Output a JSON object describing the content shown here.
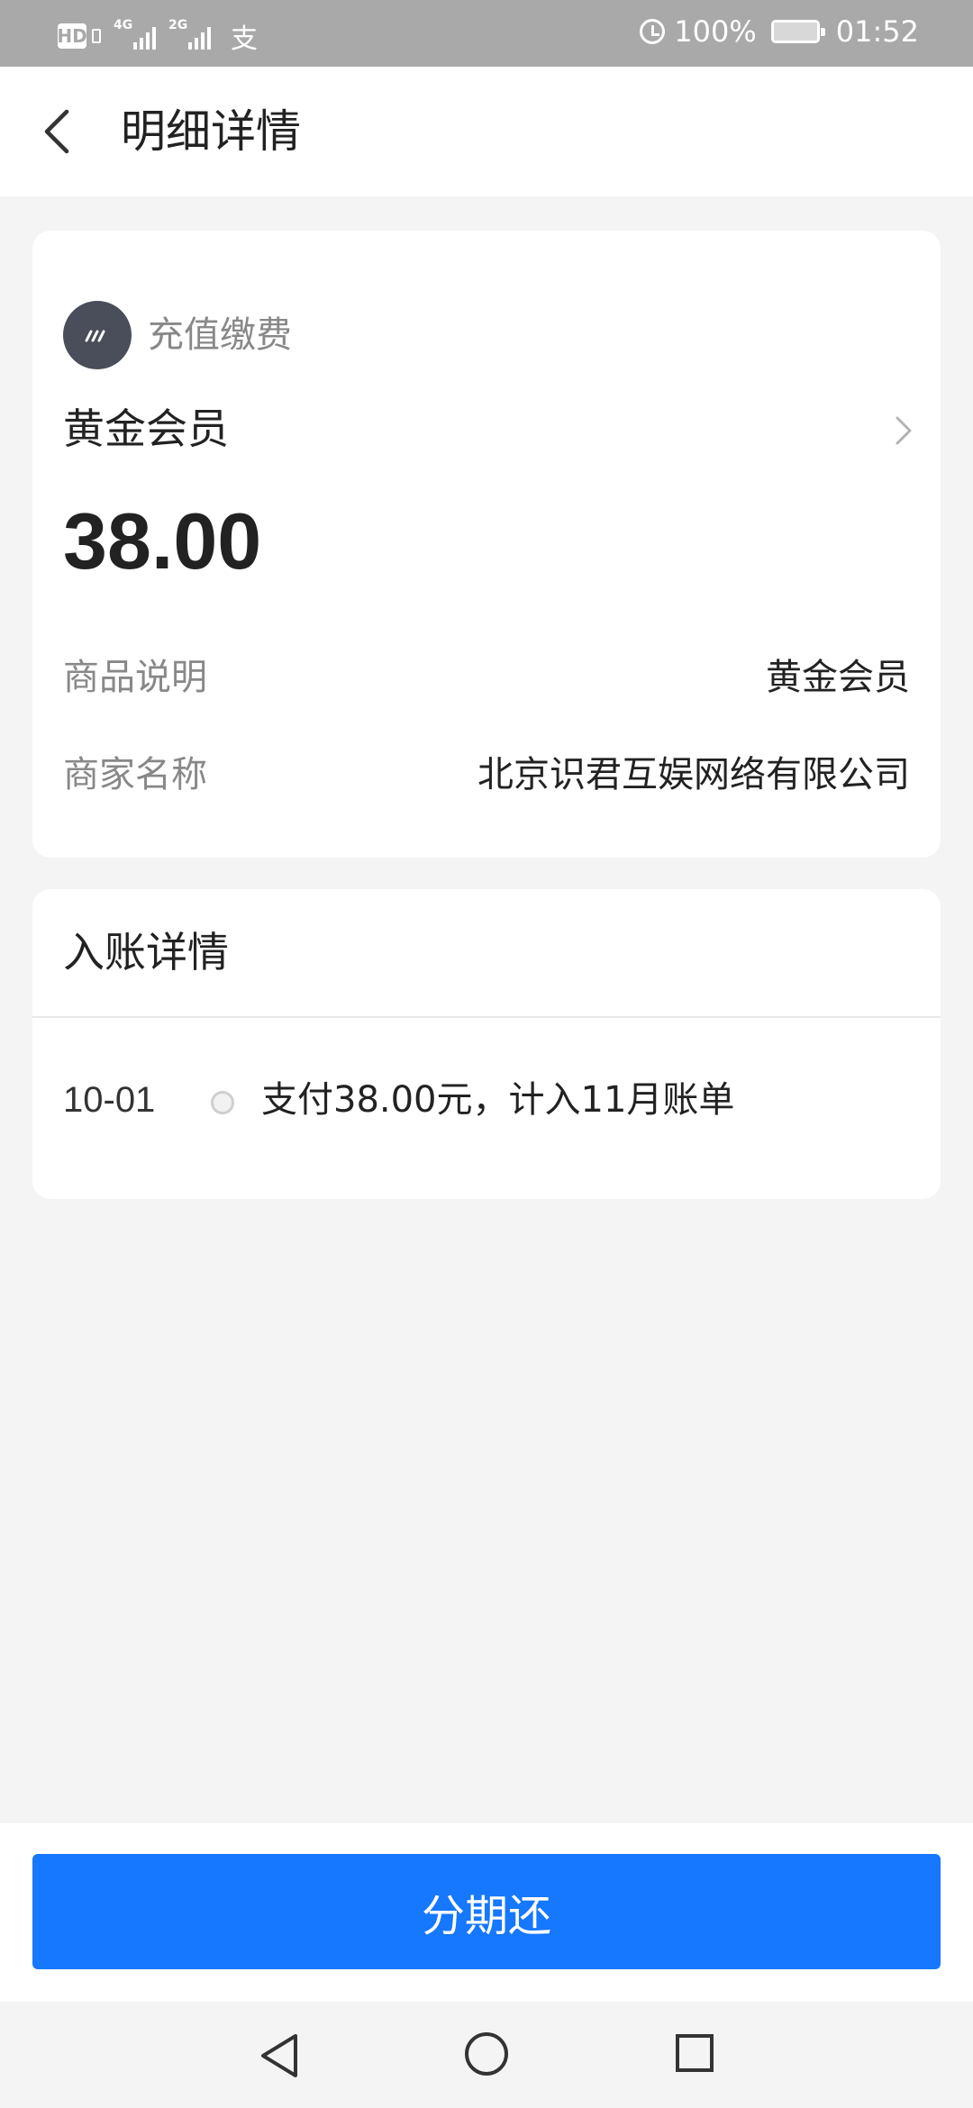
{
  "status_bar": {
    "hd_badge": "HD",
    "net_1": "4G",
    "net_2": "2G",
    "alipay_glyph": "支",
    "battery": "100%",
    "time": "01:52"
  },
  "header": {
    "title": "明细详情",
    "back_icon": "chevron-left-icon"
  },
  "detail": {
    "category": "充值缴费",
    "product": "黄金会员",
    "amount": "38.00",
    "rows": [
      {
        "label": "商品说明",
        "value": "黄金会员"
      },
      {
        "label": "商家名称",
        "value": "北京识君互娱网络有限公司"
      }
    ]
  },
  "entry": {
    "title": "入账详情",
    "items": [
      {
        "date": "10-01",
        "text": "支付38.00元，计入11月账单"
      }
    ]
  },
  "action": {
    "button_label": "分期还",
    "color": "#1677ff"
  },
  "nav_bar": {
    "icons": [
      "back-triangle-icon",
      "home-circle-icon",
      "recent-square-icon"
    ]
  }
}
